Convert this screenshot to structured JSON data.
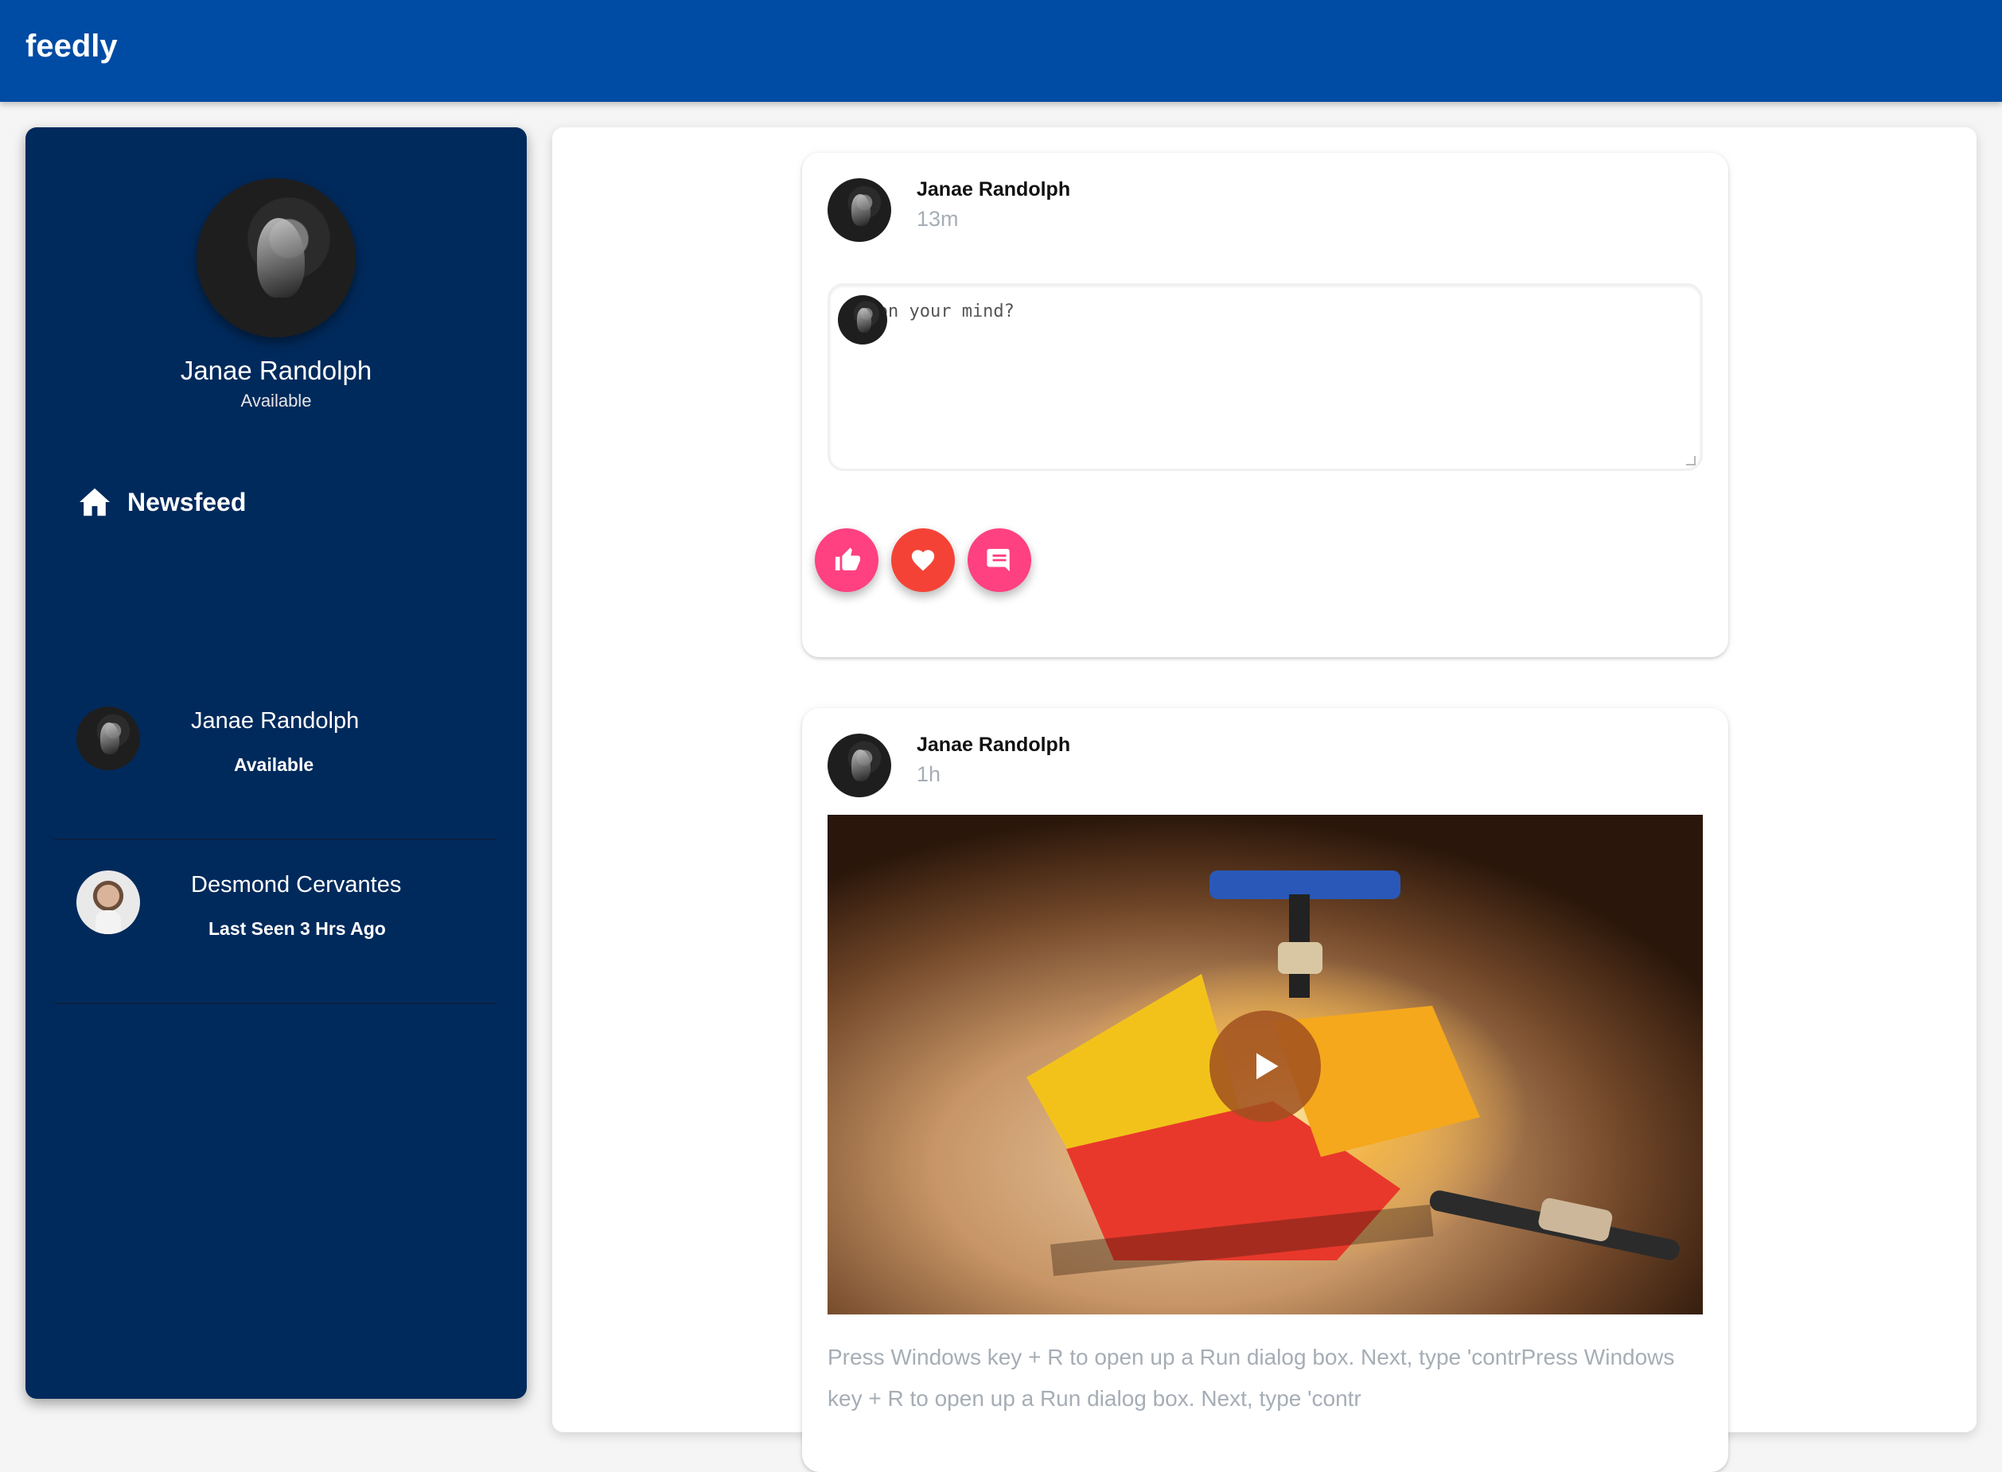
{
  "app": {
    "brand": "feedly"
  },
  "sidebar": {
    "profile": {
      "name": "Janae Randolph",
      "status": "Available"
    },
    "nav": {
      "label": "Newsfeed",
      "icon": "home-icon"
    },
    "contacts": [
      {
        "name": "Janae Randolph",
        "status": "Available"
      },
      {
        "name": "Desmond Cervantes",
        "status": "Last Seen 3 Hrs Ago"
      }
    ]
  },
  "composer_card": {
    "author": "Janae Randolph",
    "time": "13m",
    "placeholder": "What's on your mind?",
    "visible_text": "'s on your mind?",
    "actions": [
      {
        "icon": "thumbs-up-icon",
        "color": "#ff4081"
      },
      {
        "icon": "heart-icon",
        "color": "#f44336"
      },
      {
        "icon": "comment-icon",
        "color": "#ff4081"
      }
    ]
  },
  "post_card": {
    "author": "Janae Randolph",
    "time": "1h",
    "media": {
      "type": "video",
      "icon": "play-icon"
    },
    "text": "Press Windows key + R to open up a Run dialog box. Next, type 'contrPress Windows key + R to open up a Run dialog box. Next, type 'contr"
  },
  "colors": {
    "topbar": "#004ba3",
    "sidebar": "#002a5c",
    "muted_text": "#a6adb5"
  }
}
